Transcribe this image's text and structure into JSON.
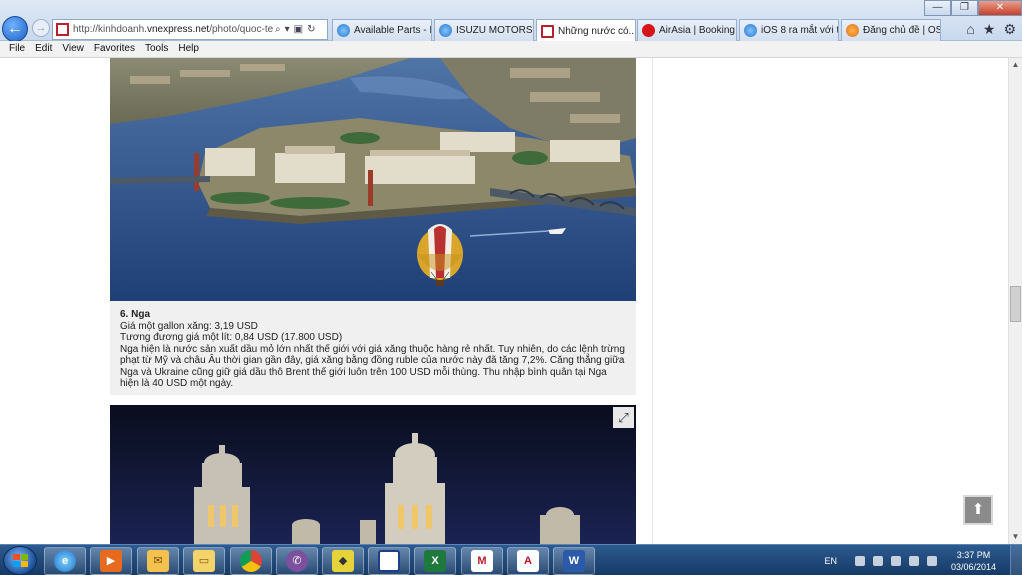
{
  "browser": {
    "url_prefix": "http://kinhdoanh.",
    "url_domain": "vnexpress.net",
    "url_rest": "/photo/quoc-te/nh",
    "tabs": [
      {
        "label": "Available Parts - I...",
        "active": false
      },
      {
        "label": "ISUZU MOTORS P...",
        "active": false
      },
      {
        "label": "Những nước có...",
        "active": true
      },
      {
        "label": "AirAsia | Booking | ...",
        "active": false
      },
      {
        "label": "iOS 8 ra mắt với tố...",
        "active": false
      },
      {
        "label": "Đăng chủ đề | OS ...",
        "active": false
      }
    ]
  },
  "menu": [
    "File",
    "Edit",
    "View",
    "Favorites",
    "Tools",
    "Help"
  ],
  "article": {
    "title": "6. Nga",
    "lines": [
      "Giá một gallon xăng: 3,19 USD",
      "Tương đương giá một lít: 0,84 USD (17.800 USD)",
      "Nga hiện là nước sản xuất dầu mỏ lớn nhất thế giới với giá xăng thuộc hàng rẻ nhất. Tuy nhiên, do các lệnh trừng phạt từ Mỹ và châu Âu thời gian gần đây, giá xăng bằng đồng ruble của nước này đã tăng 7,2%. Căng thẳng giữa Nga và Ukraine cũng giữ giá dầu thô Brent thế giới luôn trên 100 USD mỗi thùng. Thu nhập bình quân tại Nga hiện là 40 USD một ngày."
    ]
  },
  "icons": {
    "expand": "expand-icon",
    "scroll_top": "arrow-up-icon"
  },
  "taskbar": {
    "language": "EN",
    "time": "3:37 PM",
    "date": "03/06/2014"
  }
}
